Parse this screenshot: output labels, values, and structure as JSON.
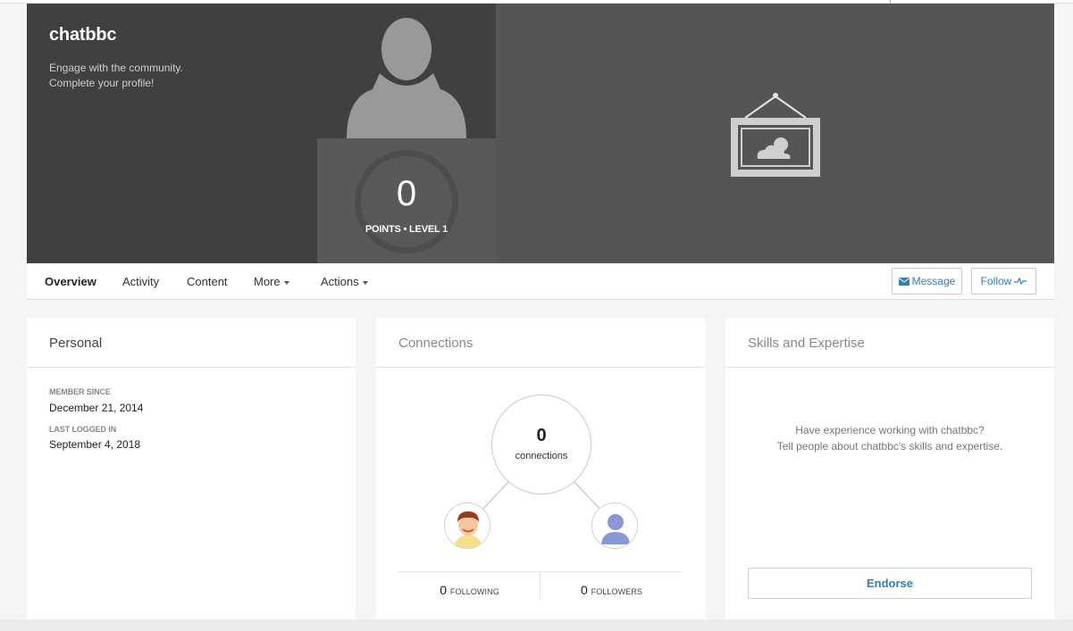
{
  "profile": {
    "username": "chatbbc",
    "tagline_line1": "Engage with the community.",
    "tagline_line2": "Complete your profile!",
    "points": "0",
    "points_label": "POINTS • LEVEL 1"
  },
  "nav": {
    "tabs": [
      {
        "label": "Overview",
        "active": true
      },
      {
        "label": "Activity"
      },
      {
        "label": "Content"
      },
      {
        "label": "More"
      },
      {
        "label": "Actions"
      }
    ],
    "message_label": "Message",
    "follow_label": "Follow"
  },
  "personal": {
    "title": "Personal",
    "member_since_label": "MEMBER SINCE",
    "member_since": "December 21, 2014",
    "last_logged_label": "LAST LOGGED IN",
    "last_logged": "September 4, 2018"
  },
  "connections": {
    "title": "Connections",
    "count": "0",
    "count_label": "connections",
    "following_count": "0",
    "following_label": "FOLLOWING",
    "followers_count": "0",
    "followers_label": "FOLLOWERS"
  },
  "skills": {
    "title": "Skills and Expertise",
    "prompt_line1": "Have experience working with chatbbc?",
    "prompt_line2": "Tell people about chatbbc's skills and expertise.",
    "endorse_label": "Endorse"
  },
  "icons": {
    "avatar": "person-silhouette-icon",
    "cover": "framed-picture-icon",
    "message": "envelope-icon",
    "follow": "pulse-icon"
  },
  "colors": {
    "accent": "#2d7fc1",
    "banner_dark": "#404040",
    "banner_mid": "#555555"
  }
}
